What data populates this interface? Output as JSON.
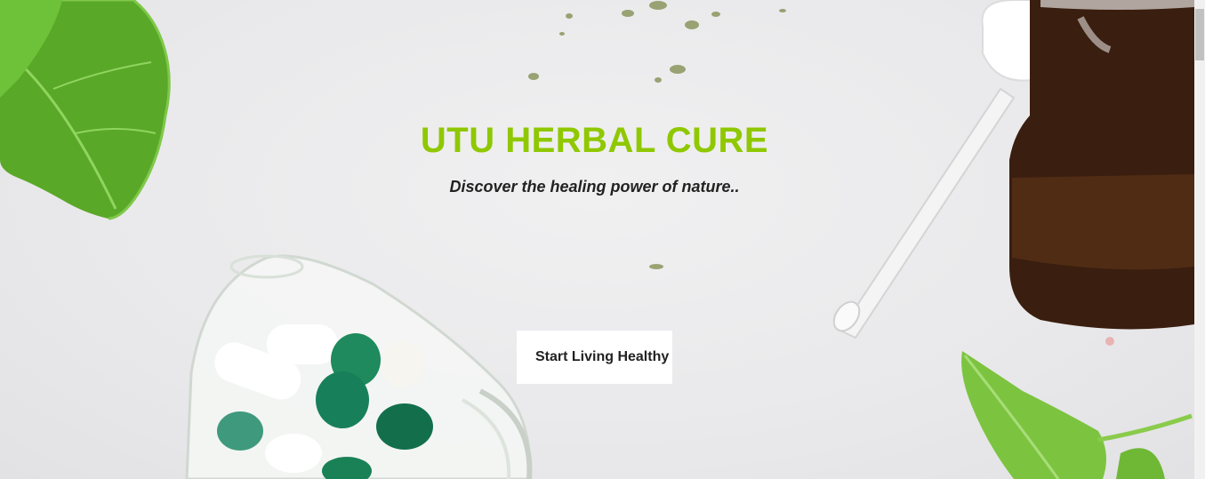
{
  "hero": {
    "title": "UTU HERBAL CURE",
    "subtitle": "Discover the healing power of nature..",
    "cta_label": "Start Living Healthy"
  },
  "colors": {
    "title": "#8fc800",
    "cta_background": "#ffffff",
    "text_dark": "#222222",
    "leaf_green": "#5fb32a",
    "capsule_green": "#1f8a5e",
    "bottle_brown": "#3a1f10"
  },
  "icons": {
    "top_left": "mint-leaf-image",
    "bottom_left": "capsule-bottle-image",
    "right": "amber-dropper-bottle-image",
    "bottom_right": "mint-sprig-image"
  }
}
